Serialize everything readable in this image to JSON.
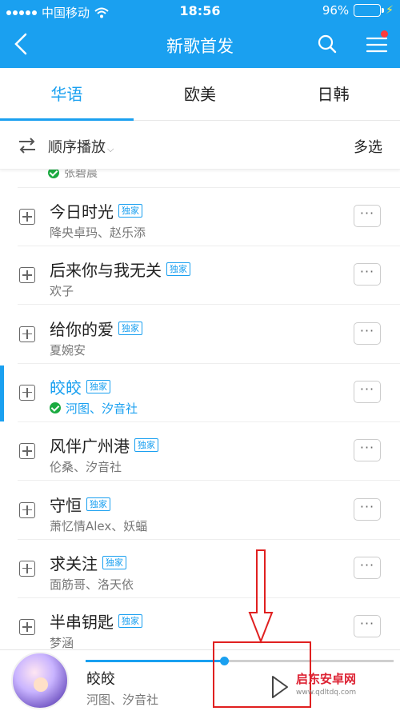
{
  "status": {
    "carrier": "中国移动",
    "time": "18:56",
    "battery": "96%",
    "battery_level": 0.96
  },
  "nav": {
    "title": "新歌首发"
  },
  "tabs": [
    {
      "label": "华语"
    },
    {
      "label": "欧美"
    },
    {
      "label": "日韩"
    }
  ],
  "toolbar": {
    "mode": "顺序播放",
    "multi": "多选"
  },
  "partial_row": {
    "artist": "张碧晨"
  },
  "songs": [
    {
      "title": "今日时光",
      "badge": "独家",
      "artist": "降央卓玛、赵乐添"
    },
    {
      "title": "后来你与我无关",
      "badge": "独家",
      "artist": "欢子"
    },
    {
      "title": "给你的爱",
      "badge": "独家",
      "artist": "夏婉安"
    },
    {
      "title": "皎皎",
      "badge": "独家",
      "artist": "河图、汐音社"
    },
    {
      "title": "风伴广州港",
      "badge": "独家",
      "artist": "伦桑、汐音社"
    },
    {
      "title": "守恒",
      "badge": "独家",
      "artist": "萧忆情Alex、妖蝠"
    },
    {
      "title": "求关注",
      "badge": "独家",
      "artist": "面筋哥、洛天依"
    },
    {
      "title": "半串钥匙",
      "badge": "独家",
      "artist": "梦涵"
    }
  ],
  "more_label": "···",
  "player": {
    "title": "皎皎",
    "artist": "河图、汐音社",
    "progress": 0.45
  },
  "watermark": {
    "name": "启东安卓网",
    "url": "www.qdltdq.com"
  },
  "colors": {
    "accent": "#1aa0f0",
    "annotation": "#e02020"
  }
}
